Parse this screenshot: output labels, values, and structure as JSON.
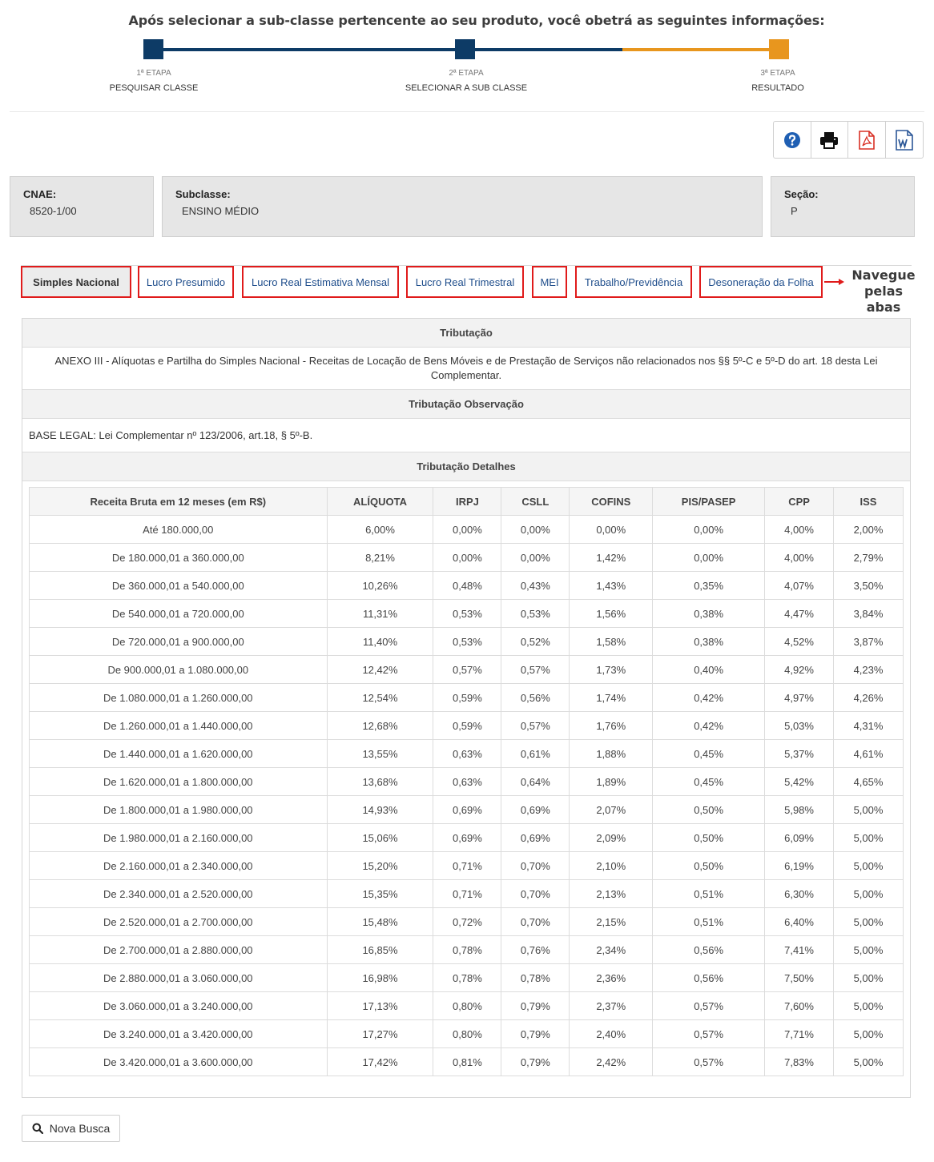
{
  "header": {
    "headline": "Após selecionar a sub-classe pertencente ao seu produto, você obetrá as seguintes informações:",
    "colors": {
      "blue": "#0d3b66",
      "orange": "#e8961e"
    },
    "steps": [
      {
        "number": "1ª ETAPA",
        "label": "PESQUISAR CLASSE"
      },
      {
        "number": "2ª ETAPA",
        "label": "SELECIONAR A SUB CLASSE"
      },
      {
        "number": "3ª ETAPA",
        "label": "RESULTADO"
      }
    ]
  },
  "toolbar": {
    "icons": [
      "help-icon",
      "print-icon",
      "pdf-icon",
      "word-icon"
    ]
  },
  "info": {
    "cnae": {
      "label": "CNAE:",
      "value": "8520-1/00"
    },
    "subclasse": {
      "label": "Subclasse:",
      "value": "ENSINO MÉDIO"
    },
    "secao": {
      "label": "Seção:",
      "value": "P"
    }
  },
  "tabs": [
    "Simples Nacional",
    "Lucro Presumido",
    "Lucro Real Estimativa Mensal",
    "Lucro Real Trimestral",
    "MEI",
    "Trabalho/Previdência",
    "Desoneração da Folha"
  ],
  "hint": {
    "line1": "Navegue",
    "line2": "pelas abas"
  },
  "panel": {
    "tributacao_title": "Tributação",
    "tributacao_text": "ANEXO III - Alíquotas e Partilha do Simples Nacional - Receitas de Locação de Bens Móveis e de Prestação de Serviços não relacionados nos §§ 5º-C e 5º-D do art. 18 desta Lei Complementar.",
    "observacao_title": "Tributação Observação",
    "observacao_text": "BASE LEGAL: Lei Complementar nº 123/2006, art.18, § 5º-B.",
    "detalhes_title": "Tributação Detalhes"
  },
  "table": {
    "headers": [
      "Receita Bruta em 12 meses (em R$)",
      "ALÍQUOTA",
      "IRPJ",
      "CSLL",
      "COFINS",
      "PIS/PASEP",
      "CPP",
      "ISS"
    ],
    "rows": [
      [
        "Até 180.000,00",
        "6,00%",
        "0,00%",
        "0,00%",
        "0,00%",
        "0,00%",
        "4,00%",
        "2,00%"
      ],
      [
        "De 180.000,01 a 360.000,00",
        "8,21%",
        "0,00%",
        "0,00%",
        "1,42%",
        "0,00%",
        "4,00%",
        "2,79%"
      ],
      [
        "De 360.000,01 a 540.000,00",
        "10,26%",
        "0,48%",
        "0,43%",
        "1,43%",
        "0,35%",
        "4,07%",
        "3,50%"
      ],
      [
        "De 540.000,01 a 720.000,00",
        "11,31%",
        "0,53%",
        "0,53%",
        "1,56%",
        "0,38%",
        "4,47%",
        "3,84%"
      ],
      [
        "De 720.000,01 a 900.000,00",
        "11,40%",
        "0,53%",
        "0,52%",
        "1,58%",
        "0,38%",
        "4,52%",
        "3,87%"
      ],
      [
        "De 900.000,01 a 1.080.000,00",
        "12,42%",
        "0,57%",
        "0,57%",
        "1,73%",
        "0,40%",
        "4,92%",
        "4,23%"
      ],
      [
        "De 1.080.000,01 a 1.260.000,00",
        "12,54%",
        "0,59%",
        "0,56%",
        "1,74%",
        "0,42%",
        "4,97%",
        "4,26%"
      ],
      [
        "De 1.260.000,01 a 1.440.000,00",
        "12,68%",
        "0,59%",
        "0,57%",
        "1,76%",
        "0,42%",
        "5,03%",
        "4,31%"
      ],
      [
        "De 1.440.000,01 a 1.620.000,00",
        "13,55%",
        "0,63%",
        "0,61%",
        "1,88%",
        "0,45%",
        "5,37%",
        "4,61%"
      ],
      [
        "De 1.620.000,01 a 1.800.000,00",
        "13,68%",
        "0,63%",
        "0,64%",
        "1,89%",
        "0,45%",
        "5,42%",
        "4,65%"
      ],
      [
        "De 1.800.000,01 a 1.980.000,00",
        "14,93%",
        "0,69%",
        "0,69%",
        "2,07%",
        "0,50%",
        "5,98%",
        "5,00%"
      ],
      [
        "De 1.980.000,01 a 2.160.000,00",
        "15,06%",
        "0,69%",
        "0,69%",
        "2,09%",
        "0,50%",
        "6,09%",
        "5,00%"
      ],
      [
        "De 2.160.000,01 a 2.340.000,00",
        "15,20%",
        "0,71%",
        "0,70%",
        "2,10%",
        "0,50%",
        "6,19%",
        "5,00%"
      ],
      [
        "De 2.340.000,01 a 2.520.000,00",
        "15,35%",
        "0,71%",
        "0,70%",
        "2,13%",
        "0,51%",
        "6,30%",
        "5,00%"
      ],
      [
        "De 2.520.000,01 a 2.700.000,00",
        "15,48%",
        "0,72%",
        "0,70%",
        "2,15%",
        "0,51%",
        "6,40%",
        "5,00%"
      ],
      [
        "De 2.700.000,01 a 2.880.000,00",
        "16,85%",
        "0,78%",
        "0,76%",
        "2,34%",
        "0,56%",
        "7,41%",
        "5,00%"
      ],
      [
        "De 2.880.000,01 a 3.060.000,00",
        "16,98%",
        "0,78%",
        "0,78%",
        "2,36%",
        "0,56%",
        "7,50%",
        "5,00%"
      ],
      [
        "De 3.060.000,01 a 3.240.000,00",
        "17,13%",
        "0,80%",
        "0,79%",
        "2,37%",
        "0,57%",
        "7,60%",
        "5,00%"
      ],
      [
        "De 3.240.000,01 a 3.420.000,00",
        "17,27%",
        "0,80%",
        "0,79%",
        "2,40%",
        "0,57%",
        "7,71%",
        "5,00%"
      ],
      [
        "De 3.420.000,01 a 3.600.000,00",
        "17,42%",
        "0,81%",
        "0,79%",
        "2,42%",
        "0,57%",
        "7,83%",
        "5,00%"
      ]
    ]
  },
  "nova_busca": {
    "label": "Nova Busca",
    "icon": "search-icon"
  }
}
